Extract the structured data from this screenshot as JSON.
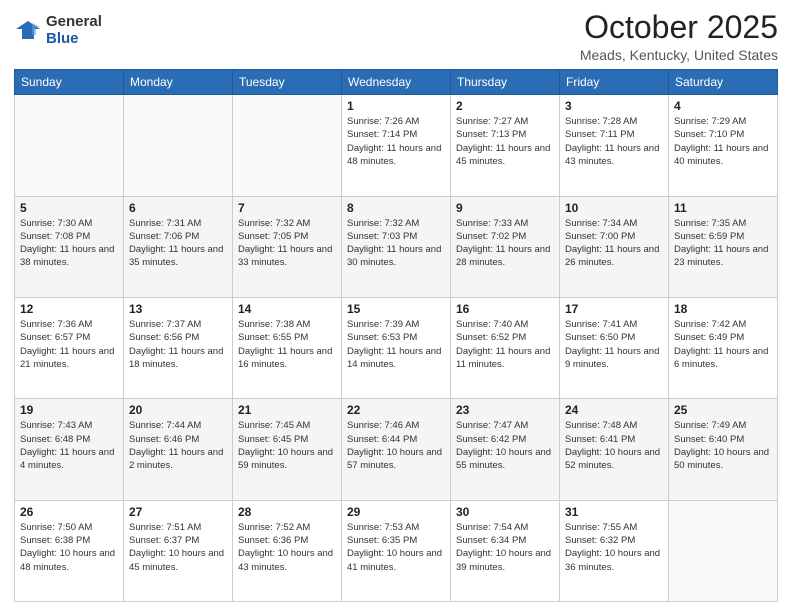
{
  "logo": {
    "general": "General",
    "blue": "Blue"
  },
  "header": {
    "month": "October 2025",
    "location": "Meads, Kentucky, United States"
  },
  "weekdays": [
    "Sunday",
    "Monday",
    "Tuesday",
    "Wednesday",
    "Thursday",
    "Friday",
    "Saturday"
  ],
  "weeks": [
    [
      {
        "day": "",
        "sunrise": "",
        "sunset": "",
        "daylight": ""
      },
      {
        "day": "",
        "sunrise": "",
        "sunset": "",
        "daylight": ""
      },
      {
        "day": "",
        "sunrise": "",
        "sunset": "",
        "daylight": ""
      },
      {
        "day": "1",
        "sunrise": "Sunrise: 7:26 AM",
        "sunset": "Sunset: 7:14 PM",
        "daylight": "Daylight: 11 hours and 48 minutes."
      },
      {
        "day": "2",
        "sunrise": "Sunrise: 7:27 AM",
        "sunset": "Sunset: 7:13 PM",
        "daylight": "Daylight: 11 hours and 45 minutes."
      },
      {
        "day": "3",
        "sunrise": "Sunrise: 7:28 AM",
        "sunset": "Sunset: 7:11 PM",
        "daylight": "Daylight: 11 hours and 43 minutes."
      },
      {
        "day": "4",
        "sunrise": "Sunrise: 7:29 AM",
        "sunset": "Sunset: 7:10 PM",
        "daylight": "Daylight: 11 hours and 40 minutes."
      }
    ],
    [
      {
        "day": "5",
        "sunrise": "Sunrise: 7:30 AM",
        "sunset": "Sunset: 7:08 PM",
        "daylight": "Daylight: 11 hours and 38 minutes."
      },
      {
        "day": "6",
        "sunrise": "Sunrise: 7:31 AM",
        "sunset": "Sunset: 7:06 PM",
        "daylight": "Daylight: 11 hours and 35 minutes."
      },
      {
        "day": "7",
        "sunrise": "Sunrise: 7:32 AM",
        "sunset": "Sunset: 7:05 PM",
        "daylight": "Daylight: 11 hours and 33 minutes."
      },
      {
        "day": "8",
        "sunrise": "Sunrise: 7:32 AM",
        "sunset": "Sunset: 7:03 PM",
        "daylight": "Daylight: 11 hours and 30 minutes."
      },
      {
        "day": "9",
        "sunrise": "Sunrise: 7:33 AM",
        "sunset": "Sunset: 7:02 PM",
        "daylight": "Daylight: 11 hours and 28 minutes."
      },
      {
        "day": "10",
        "sunrise": "Sunrise: 7:34 AM",
        "sunset": "Sunset: 7:00 PM",
        "daylight": "Daylight: 11 hours and 26 minutes."
      },
      {
        "day": "11",
        "sunrise": "Sunrise: 7:35 AM",
        "sunset": "Sunset: 6:59 PM",
        "daylight": "Daylight: 11 hours and 23 minutes."
      }
    ],
    [
      {
        "day": "12",
        "sunrise": "Sunrise: 7:36 AM",
        "sunset": "Sunset: 6:57 PM",
        "daylight": "Daylight: 11 hours and 21 minutes."
      },
      {
        "day": "13",
        "sunrise": "Sunrise: 7:37 AM",
        "sunset": "Sunset: 6:56 PM",
        "daylight": "Daylight: 11 hours and 18 minutes."
      },
      {
        "day": "14",
        "sunrise": "Sunrise: 7:38 AM",
        "sunset": "Sunset: 6:55 PM",
        "daylight": "Daylight: 11 hours and 16 minutes."
      },
      {
        "day": "15",
        "sunrise": "Sunrise: 7:39 AM",
        "sunset": "Sunset: 6:53 PM",
        "daylight": "Daylight: 11 hours and 14 minutes."
      },
      {
        "day": "16",
        "sunrise": "Sunrise: 7:40 AM",
        "sunset": "Sunset: 6:52 PM",
        "daylight": "Daylight: 11 hours and 11 minutes."
      },
      {
        "day": "17",
        "sunrise": "Sunrise: 7:41 AM",
        "sunset": "Sunset: 6:50 PM",
        "daylight": "Daylight: 11 hours and 9 minutes."
      },
      {
        "day": "18",
        "sunrise": "Sunrise: 7:42 AM",
        "sunset": "Sunset: 6:49 PM",
        "daylight": "Daylight: 11 hours and 6 minutes."
      }
    ],
    [
      {
        "day": "19",
        "sunrise": "Sunrise: 7:43 AM",
        "sunset": "Sunset: 6:48 PM",
        "daylight": "Daylight: 11 hours and 4 minutes."
      },
      {
        "day": "20",
        "sunrise": "Sunrise: 7:44 AM",
        "sunset": "Sunset: 6:46 PM",
        "daylight": "Daylight: 11 hours and 2 minutes."
      },
      {
        "day": "21",
        "sunrise": "Sunrise: 7:45 AM",
        "sunset": "Sunset: 6:45 PM",
        "daylight": "Daylight: 10 hours and 59 minutes."
      },
      {
        "day": "22",
        "sunrise": "Sunrise: 7:46 AM",
        "sunset": "Sunset: 6:44 PM",
        "daylight": "Daylight: 10 hours and 57 minutes."
      },
      {
        "day": "23",
        "sunrise": "Sunrise: 7:47 AM",
        "sunset": "Sunset: 6:42 PM",
        "daylight": "Daylight: 10 hours and 55 minutes."
      },
      {
        "day": "24",
        "sunrise": "Sunrise: 7:48 AM",
        "sunset": "Sunset: 6:41 PM",
        "daylight": "Daylight: 10 hours and 52 minutes."
      },
      {
        "day": "25",
        "sunrise": "Sunrise: 7:49 AM",
        "sunset": "Sunset: 6:40 PM",
        "daylight": "Daylight: 10 hours and 50 minutes."
      }
    ],
    [
      {
        "day": "26",
        "sunrise": "Sunrise: 7:50 AM",
        "sunset": "Sunset: 6:38 PM",
        "daylight": "Daylight: 10 hours and 48 minutes."
      },
      {
        "day": "27",
        "sunrise": "Sunrise: 7:51 AM",
        "sunset": "Sunset: 6:37 PM",
        "daylight": "Daylight: 10 hours and 45 minutes."
      },
      {
        "day": "28",
        "sunrise": "Sunrise: 7:52 AM",
        "sunset": "Sunset: 6:36 PM",
        "daylight": "Daylight: 10 hours and 43 minutes."
      },
      {
        "day": "29",
        "sunrise": "Sunrise: 7:53 AM",
        "sunset": "Sunset: 6:35 PM",
        "daylight": "Daylight: 10 hours and 41 minutes."
      },
      {
        "day": "30",
        "sunrise": "Sunrise: 7:54 AM",
        "sunset": "Sunset: 6:34 PM",
        "daylight": "Daylight: 10 hours and 39 minutes."
      },
      {
        "day": "31",
        "sunrise": "Sunrise: 7:55 AM",
        "sunset": "Sunset: 6:32 PM",
        "daylight": "Daylight: 10 hours and 36 minutes."
      },
      {
        "day": "",
        "sunrise": "",
        "sunset": "",
        "daylight": ""
      }
    ]
  ]
}
